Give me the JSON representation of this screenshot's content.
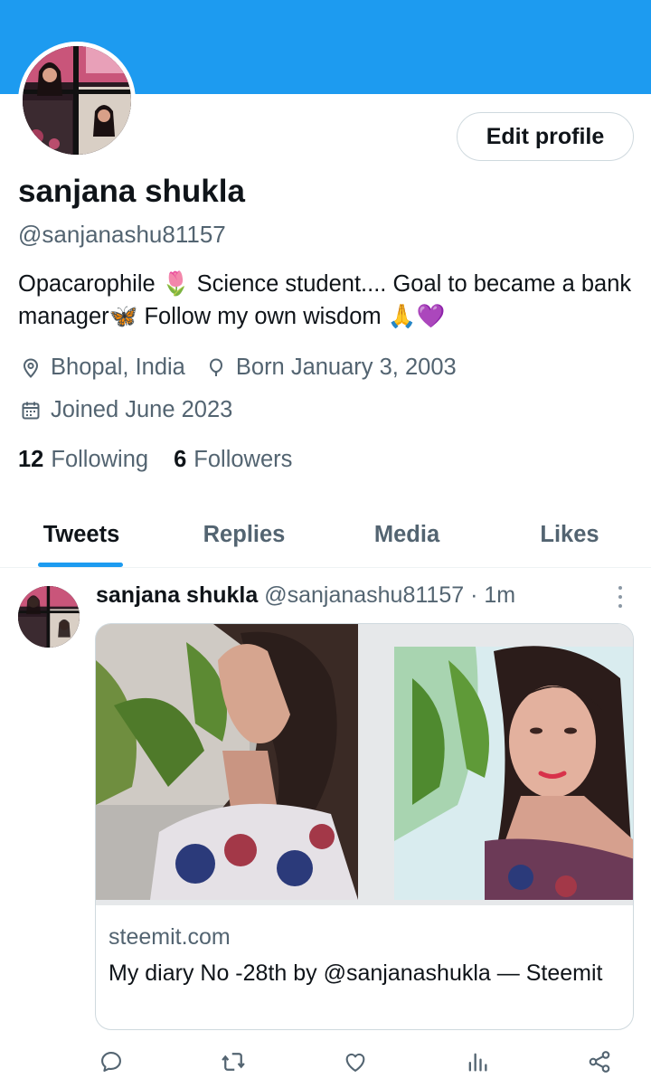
{
  "profile": {
    "banner_color": "#1d9bf0",
    "edit_label": "Edit profile",
    "name": "sanjana shukla",
    "handle": "@sanjanashu81157",
    "bio": "Opacarophile 🌷 Science student.... Goal to became a bank manager🦋 Follow my own wisdom 🙏💜",
    "location": "Bhopal, India",
    "birthday": "Born January 3, 2003",
    "joined": "Joined June 2023",
    "following_count": "12",
    "following_label": "Following",
    "followers_count": "6",
    "followers_label": "Followers",
    "icons": [
      "location-pin-icon",
      "balloon-icon",
      "calendar-icon"
    ]
  },
  "tabs": [
    {
      "label": "Tweets",
      "active": true
    },
    {
      "label": "Replies",
      "active": false
    },
    {
      "label": "Media",
      "active": false
    },
    {
      "label": "Likes",
      "active": false
    }
  ],
  "tweet": {
    "author": "sanjana shukla",
    "handle": "@sanjanashu81157",
    "separator": "·",
    "time": "1m",
    "card": {
      "domain": "steemit.com",
      "title": "My diary No -28th by @sanjanashukla — Steemit"
    },
    "actions": [
      "reply-icon",
      "retweet-icon",
      "like-icon",
      "views-icon",
      "share-icon"
    ]
  },
  "colors": {
    "accent": "#1d9bf0",
    "text": "#0f1419",
    "muted": "#536471"
  }
}
